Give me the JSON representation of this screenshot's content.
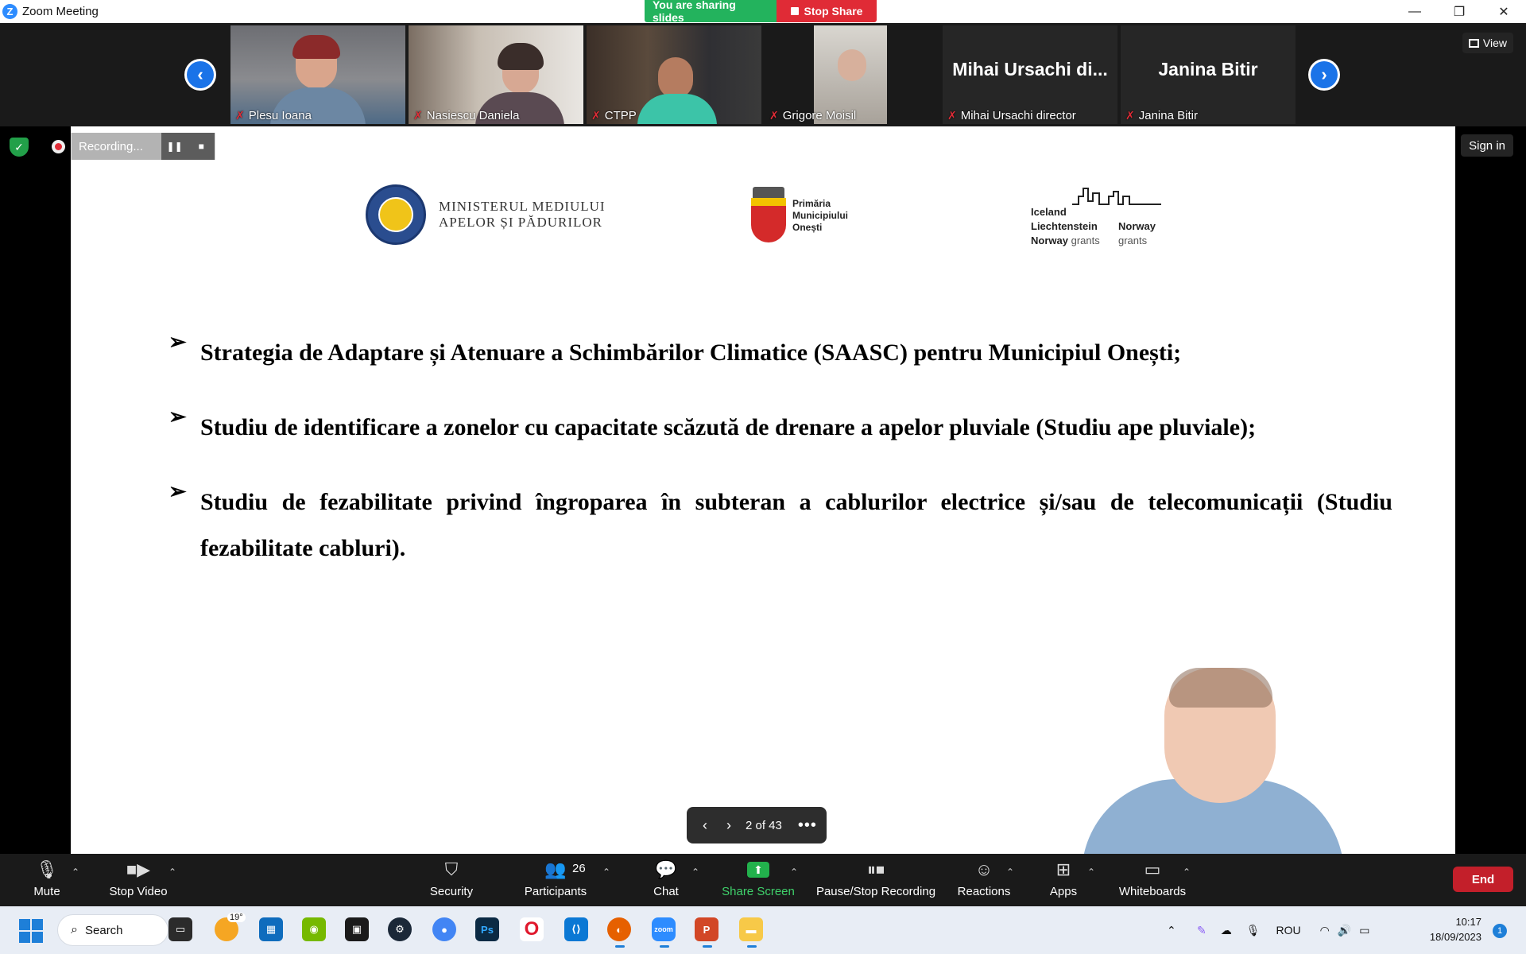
{
  "window": {
    "title": "Zoom Meeting",
    "minimize_glyph": "—",
    "maximize_glyph": "❐",
    "close_glyph": "✕"
  },
  "share_banner": {
    "sharing_label": "You are sharing slides",
    "stop_label": "Stop Share"
  },
  "participants_strip": {
    "tiles": [
      {
        "name": "Plesu Ioana",
        "muted": true
      },
      {
        "name": "Nasiescu Daniela",
        "muted": true
      },
      {
        "name": "CTPP",
        "muted": true
      },
      {
        "name": "Grigore Moisil",
        "muted": true
      },
      {
        "name": "Mihai Ursachi director",
        "display": "Mihai Ursachi di...",
        "muted": true
      },
      {
        "name": "Janina Bitir",
        "display": "Janina Bitir",
        "muted": true
      }
    ],
    "view_label": "View"
  },
  "recording": {
    "label": "Recording...",
    "pause_glyph": "❚❚",
    "stop_glyph": "■"
  },
  "signin_label": "Sign in",
  "slide": {
    "logos": {
      "ministry_line1": "MINISTERUL MEDIULUI",
      "ministry_line2": "APELOR ȘI PĂDURILOR",
      "primaria_line1": "Primăria",
      "primaria_line2": "Municipiului",
      "primaria_line3": "Onești",
      "grants_iceland": "Iceland",
      "grants_liechtenstein": "Liechtenstein",
      "grants_norway": "Norway",
      "grants_norway_right": "Norway",
      "grants_word": "grants"
    },
    "bullets": [
      "Strategia de Adaptare și Atenuare a Schimbărilor Climatice (SAASC) pentru Municipiul Onești;",
      "Studiu de identificare a zonelor cu capacitate scăzută de drenare a apelor pluviale (Studiu ape pluviale);",
      "Studiu de fezabilitate privind îngroparea în subteran a cablurilor electrice și/sau de telecomunicații (Studiu fezabilitate cabluri)."
    ],
    "bullet_glyph": "➢"
  },
  "pager": {
    "label": "2 of 43"
  },
  "toolbar": {
    "mute": "Mute",
    "stop_video": "Stop Video",
    "security": "Security",
    "participants": "Participants",
    "participants_count": "26",
    "chat": "Chat",
    "share_screen": "Share Screen",
    "recording": "Pause/Stop Recording",
    "reactions": "Reactions",
    "apps": "Apps",
    "whiteboards": "Whiteboards",
    "end": "End"
  },
  "taskbar": {
    "search_label": "Search",
    "weather_temp": "19°",
    "language": "ROU",
    "time": "10:17",
    "date": "18/09/2023",
    "notification_count": "1"
  }
}
